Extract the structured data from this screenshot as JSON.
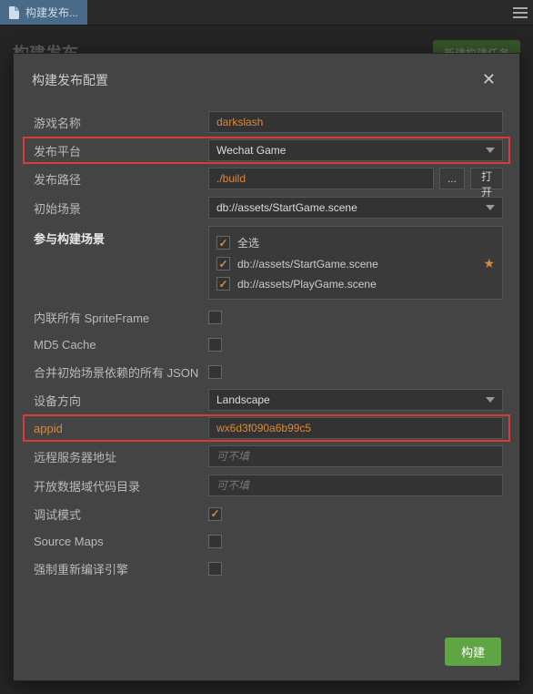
{
  "tabbar": {
    "tab_label": "构建发布..."
  },
  "background": {
    "title": "构建发布",
    "action_button": "新建构建任务"
  },
  "modal": {
    "title": "构建发布配置",
    "build_button": "构建"
  },
  "fields": {
    "game_name": {
      "label": "游戏名称",
      "value": "darkslash"
    },
    "platform": {
      "label": "发布平台",
      "value": "Wechat Game"
    },
    "build_path": {
      "label": "发布路径",
      "value": "./build",
      "browse": "...",
      "open": "打开"
    },
    "start_scene": {
      "label": "初始场景",
      "value": "db://assets/StartGame.scene"
    },
    "scenes": {
      "label": "参与构建场景",
      "select_all": "全选",
      "items": [
        {
          "path": "db://assets/StartGame.scene",
          "checked": true,
          "starred": true
        },
        {
          "path": "db://assets/PlayGame.scene",
          "checked": true,
          "starred": false
        }
      ]
    },
    "inline_sprite": {
      "label": "内联所有 SpriteFrame"
    },
    "md5": {
      "label": "MD5 Cache"
    },
    "merge_json": {
      "label": "合并初始场景依赖的所有 JSON"
    },
    "orientation": {
      "label": "设备方向",
      "value": "Landscape"
    },
    "appid": {
      "label": "appid",
      "value": "wx6d3f090a6b99c5"
    },
    "remote_server": {
      "label": "远程服务器地址",
      "placeholder": "可不填"
    },
    "open_data": {
      "label": "开放数据域代码目录",
      "placeholder": "可不填"
    },
    "debug": {
      "label": "调试模式"
    },
    "source_maps": {
      "label": "Source Maps"
    },
    "recompile": {
      "label": "强制重新编译引擎"
    }
  }
}
